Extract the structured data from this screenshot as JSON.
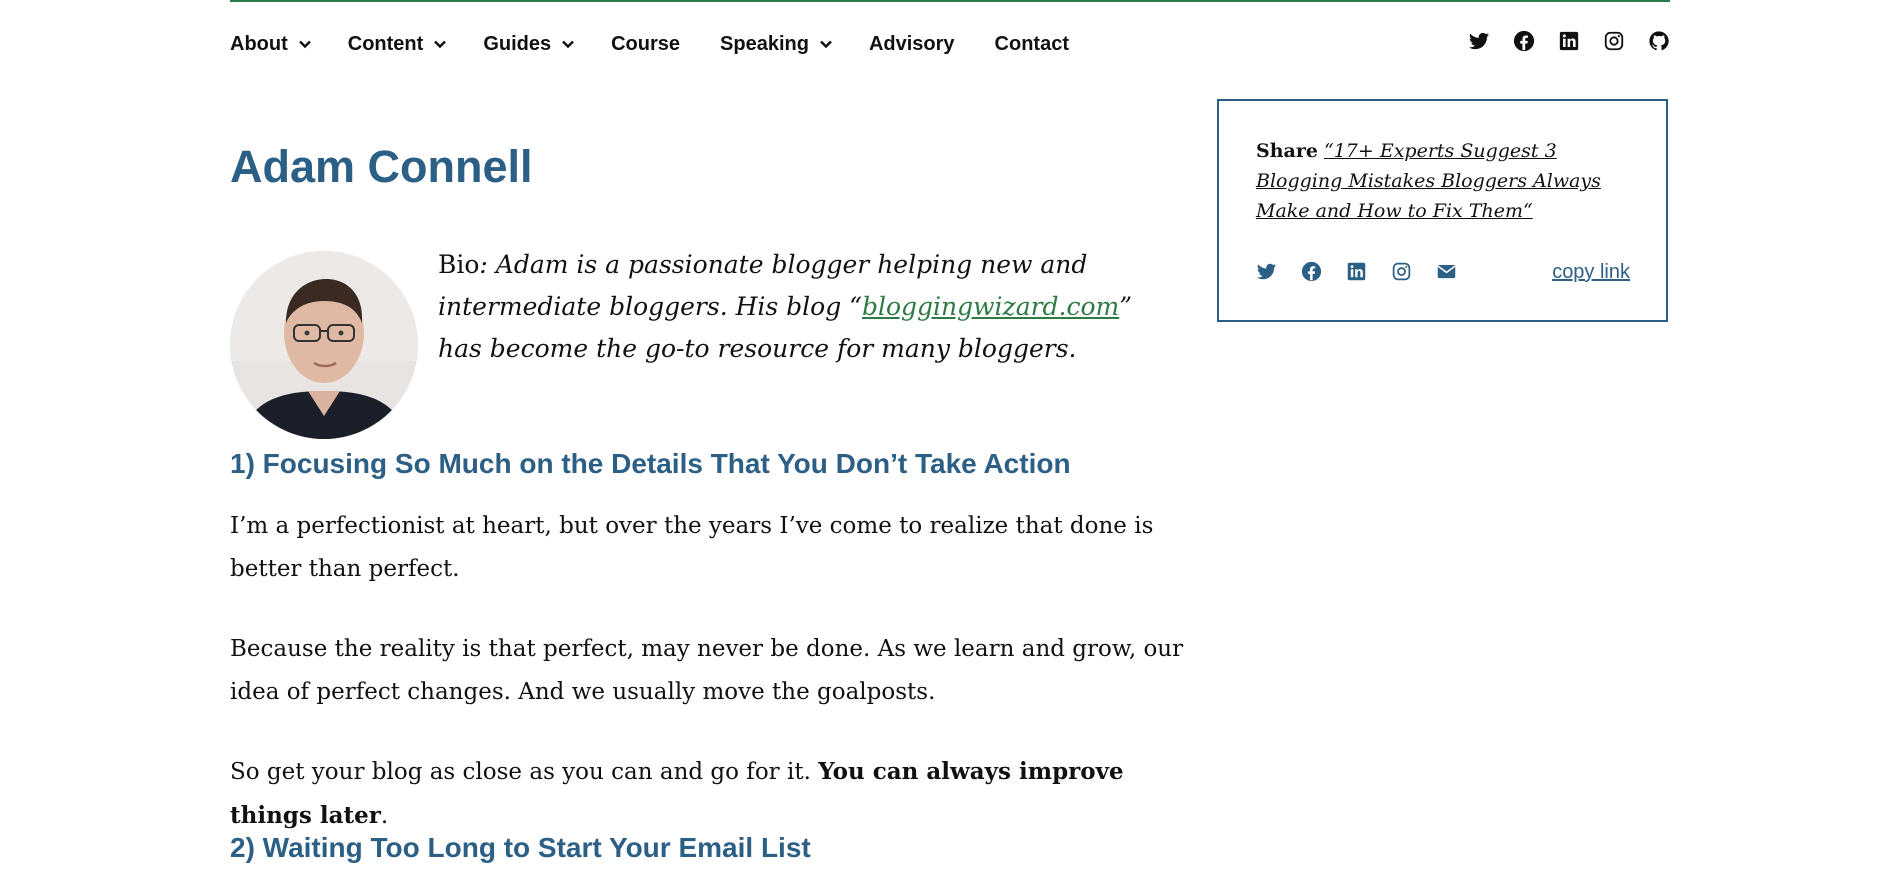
{
  "nav": {
    "items": [
      {
        "label": "About",
        "dropdown": true
      },
      {
        "label": "Content",
        "dropdown": true
      },
      {
        "label": "Guides",
        "dropdown": true
      },
      {
        "label": "Course",
        "dropdown": false
      },
      {
        "label": "Speaking",
        "dropdown": true
      },
      {
        "label": "Advisory",
        "dropdown": false
      },
      {
        "label": "Contact",
        "dropdown": false
      }
    ],
    "social_icons": [
      "twitter-icon",
      "facebook-icon",
      "linkedin-icon",
      "instagram-icon",
      "github-icon"
    ]
  },
  "article": {
    "author_name": "Adam Connell",
    "bio": {
      "label": "Bio",
      "text_before": ": Adam is a passionate blogger helping new and intermediate bloggers. His blog “",
      "link_text": "bloggingwizard.com",
      "text_after": "” has become the go-to resource for many bloggers."
    },
    "sections": [
      {
        "heading": "1) Focusing So Much on the Details That You Don’t Take Action",
        "p1": "I’m a perfectionist at heart, but over the years I’ve come to realize that done is better than perfect.",
        "p2": "Because the reality is that perfect, may never be done. As we learn and grow, our idea of perfect changes. And we usually move the goalposts.",
        "p3_start": "So get your blog as close as you can and go for it. ",
        "p3_bold": "You can always improve things later",
        "p3_end": "."
      },
      {
        "heading": "2) Waiting Too Long to Start Your Email List"
      }
    ]
  },
  "share_box": {
    "label": "Share",
    "title": "“17+ Experts Suggest 3 Blogging Mistakes Bloggers Always Make and How to Fix Them“",
    "icons": [
      "twitter-icon",
      "facebook-icon",
      "linkedin-icon",
      "instagram-icon",
      "email-icon"
    ],
    "copy_link": "copy link"
  },
  "colors": {
    "heading_blue": "#2c5f85",
    "link_green": "#2d7a45",
    "top_rule_green": "#2f7a4a"
  }
}
